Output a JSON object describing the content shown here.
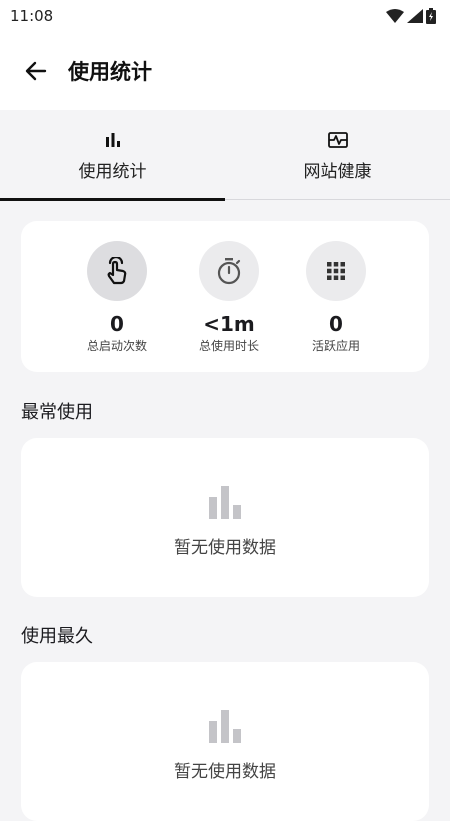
{
  "status_bar": {
    "time": "11:08"
  },
  "app_bar": {
    "title": "使用统计"
  },
  "tabs": [
    {
      "label": "使用统计",
      "icon": "bar-chart-icon",
      "selected": true
    },
    {
      "label": "网站健康",
      "icon": "monitor-heart-icon",
      "selected": false
    }
  ],
  "stats": [
    {
      "value": "0",
      "label": "总启动次数",
      "icon": "touch-icon"
    },
    {
      "value": "<1m",
      "label": "总使用时长",
      "icon": "timer-icon"
    },
    {
      "value": "0",
      "label": "活跃应用",
      "icon": "grid-icon"
    }
  ],
  "sections": {
    "most_used": {
      "title": "最常使用",
      "empty_text": "暂无使用数据"
    },
    "longest_used": {
      "title": "使用最久",
      "empty_text": "暂无使用数据"
    }
  },
  "colors": {
    "background": "#f4f4f6",
    "card": "#ffffff",
    "icon_circle_active": "#dddde0",
    "icon_circle": "#ebebed",
    "indicator": "#111111",
    "placeholder_icon": "#c4c4c8"
  }
}
